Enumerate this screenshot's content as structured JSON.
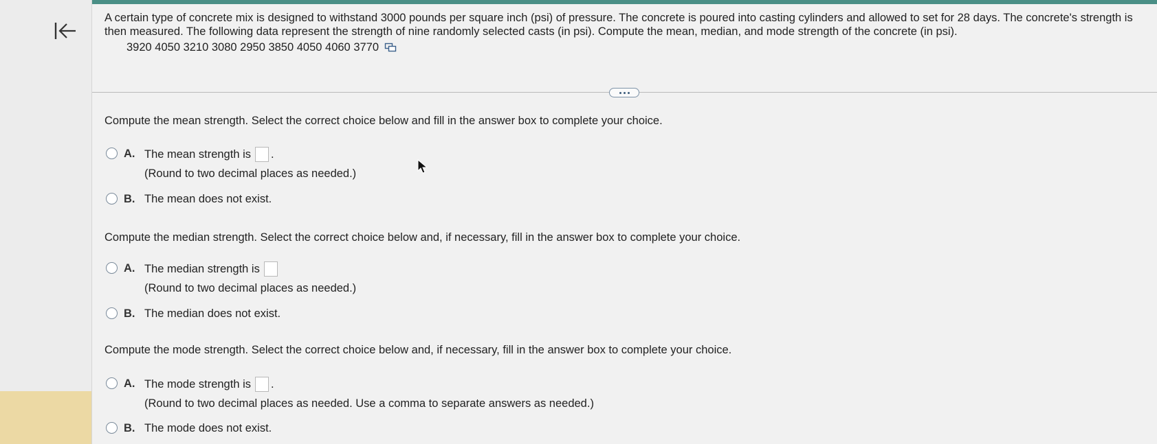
{
  "problem": {
    "text": "A certain type of concrete mix is designed to withstand 3000 pounds per square inch (psi) of pressure. The concrete is poured into casting cylinders and allowed to set for 28 days. The concrete's strength is then measured. The following data represent the strength of nine randomly selected casts (in psi). Compute the mean, median, and mode strength of the concrete (in psi).",
    "data_values": "3920 4050 3210 3080 2950 3850 4050 4060 3770"
  },
  "icons": {
    "back": "back-to-start-icon",
    "copy": "copy-data-icon",
    "more": "more-options-icon",
    "cursor": "mouse-cursor-icon"
  },
  "mean": {
    "prompt": "Compute the mean strength. Select the correct choice below and fill in the answer box to complete your choice.",
    "a_letter": "A.",
    "a_text": "The mean strength is",
    "a_value": "",
    "a_after": ".",
    "a_hint": "(Round to two decimal places as needed.)",
    "b_letter": "B.",
    "b_text": "The mean does not exist."
  },
  "median": {
    "prompt": "Compute the median strength. Select the correct choice below and, if necessary, fill in the answer box to complete your choice.",
    "a_letter": "A.",
    "a_text": "The median strength is",
    "a_value": "",
    "a_after": "",
    "a_hint": "(Round to two decimal places as needed.)",
    "b_letter": "B.",
    "b_text": "The median does not exist."
  },
  "mode": {
    "prompt": "Compute the mode strength. Select the correct choice below and, if necessary, fill in the answer box to complete your choice.",
    "a_letter": "A.",
    "a_text": "The mode strength is",
    "a_value": "",
    "a_after": ".",
    "a_hint": "(Round to two decimal places as needed. Use a comma to separate answers as needed.)",
    "b_letter": "B.",
    "b_text": "The mode does not exist."
  },
  "colors": {
    "top_accent": "#4a8f86",
    "rail_accent": "#ecd9a4"
  }
}
